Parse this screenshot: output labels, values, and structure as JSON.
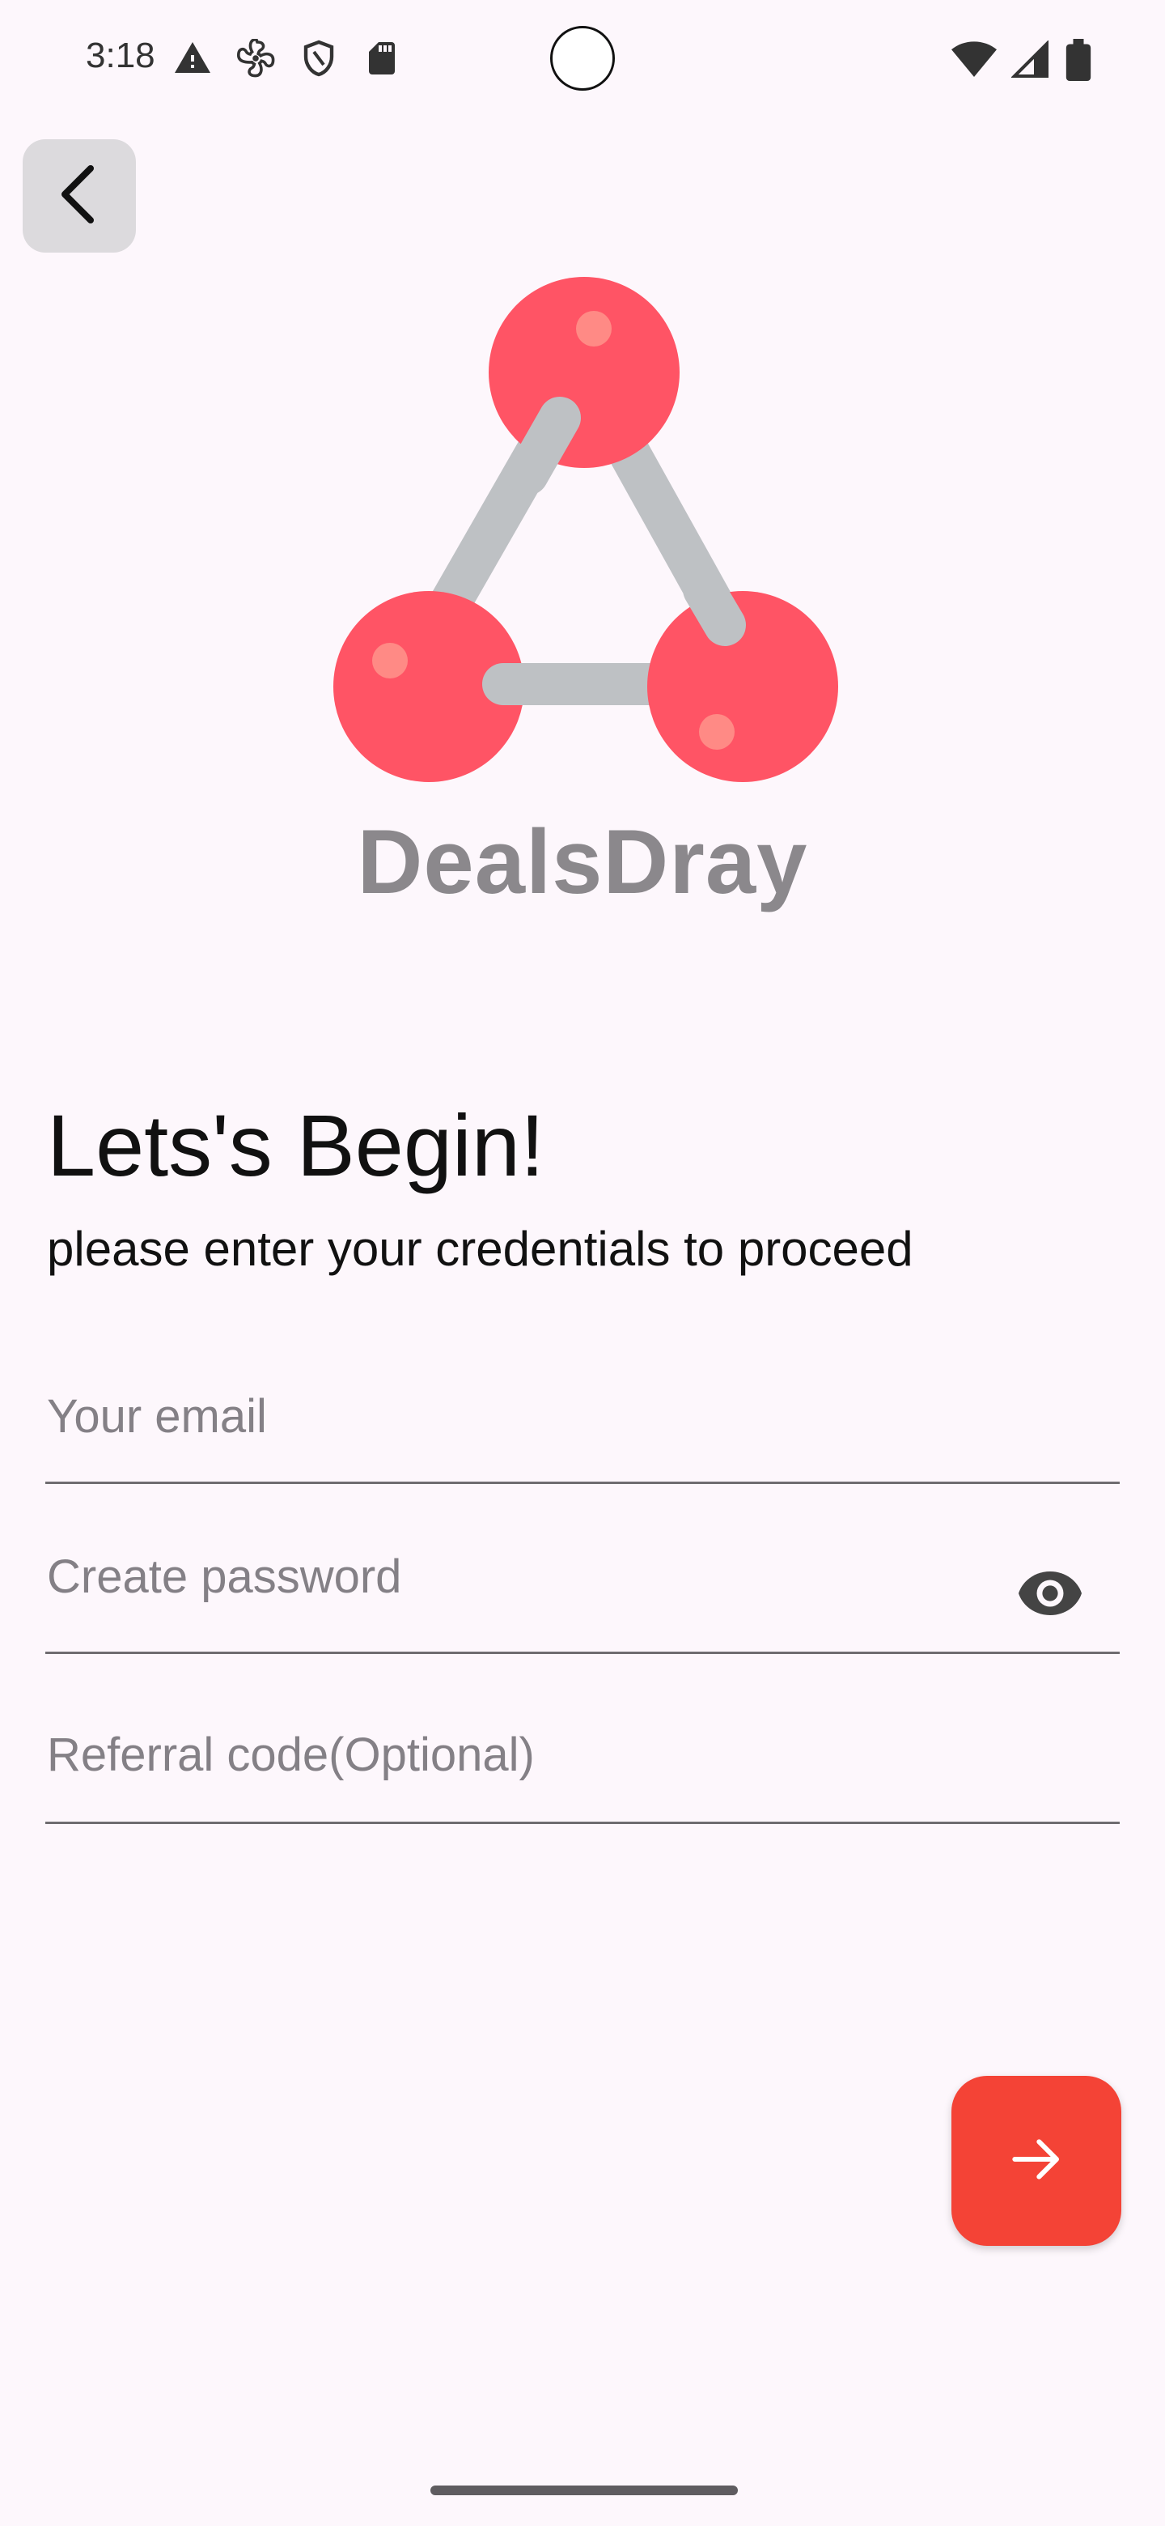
{
  "status_bar": {
    "time": "3:18",
    "left_icons": [
      "warning-icon",
      "fan-icon",
      "shield-icon",
      "sd-card-icon"
    ],
    "right_icons": [
      "wifi-icon",
      "signal-icon",
      "battery-icon"
    ]
  },
  "header": {
    "back_icon": "chevron-left-icon"
  },
  "brand": {
    "name": "DealsDray",
    "logo_colors": {
      "node": "#ff5465",
      "node_highlight": "#ff8a85",
      "link": "#bec1c4"
    }
  },
  "main": {
    "title": "Lets's Begin!",
    "subtitle": "please enter your credentials to proceed"
  },
  "form": {
    "email_placeholder": "Your email",
    "password_placeholder": "Create password",
    "referral_placeholder": "Referral code(Optional)",
    "password_toggle_icon": "eye-icon"
  },
  "actions": {
    "next_icon": "arrow-right-icon",
    "accent_color": "#f44336"
  }
}
